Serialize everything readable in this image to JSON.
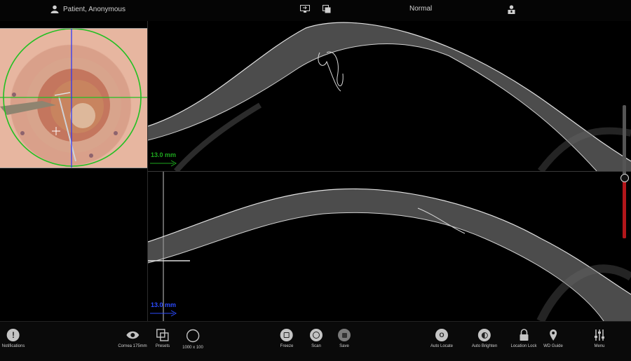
{
  "topbar": {
    "patient_name": "Patient, Anonymous",
    "mode": "Normal"
  },
  "scans": {
    "top_scale": "13.0 mm",
    "bottom_scale": "13.0 mm",
    "top_color": "#1ea81e",
    "bottom_color": "#2b4bff"
  },
  "toolbar": {
    "notifications": "Notifications",
    "cornea": "Cornea 175mm",
    "presets": "Presets",
    "resolution": "1000 x 100",
    "freeze": "Freeze",
    "scan": "Scan",
    "save": "Save",
    "auto_locate": "Auto Locate",
    "auto_brighten": "Auto Brighten",
    "location_lock": "Location Lock",
    "wd_guide": "WD Guide",
    "menu": "Menu"
  },
  "colors": {
    "accent_red": "#b3161a",
    "crosshair_green": "#22c022",
    "crosshair_blue": "#2030ff"
  }
}
